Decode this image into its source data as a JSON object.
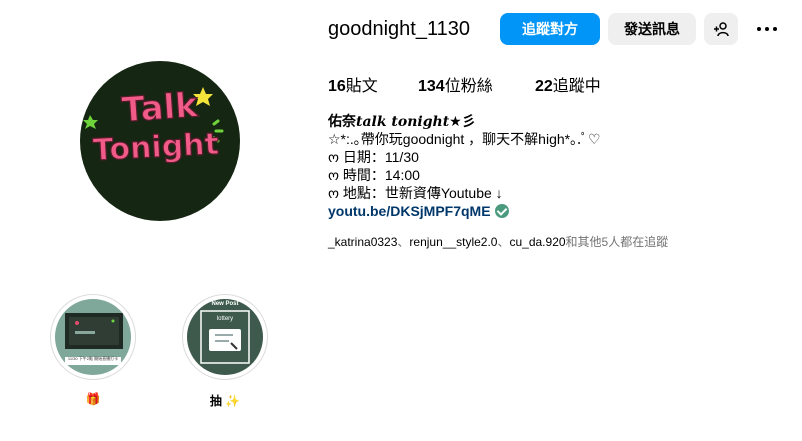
{
  "profile": {
    "username": "goodnight_1130",
    "avatar_text_line1": "Talk",
    "avatar_text_line2": "Tonight"
  },
  "actions": {
    "follow_label": "追蹤對方",
    "message_label": "發送訊息",
    "suggest_icon": "add-person-icon",
    "more_icon": "more-horizontal-icon"
  },
  "stats": {
    "posts_count": "16",
    "posts_label": "貼文",
    "followers_count": "134",
    "followers_label": "位粉絲",
    "following_count": "22",
    "following_label": "追蹤中"
  },
  "bio": {
    "name_prefix": "佑奈",
    "name_styled": "talk tonight",
    "name_suffix": "★彡",
    "line1": "☆*:.｡帶你玩goodnight ，聊天不解high*｡.ﾟ♡",
    "line2": "ო 日期：11/30",
    "line3": "ო 時間：14:00",
    "line4": "ო 地點：世新資傳Youtube ↓",
    "link": "youtu.be/DKSjMPF7qME"
  },
  "followed_by": {
    "user1": "_katrina0323",
    "sep1": "、",
    "user2": "renjun__style2.0",
    "sep2": "、",
    "user3": "cu_da.920",
    "rest": "和其他5人都在追蹤"
  },
  "highlights": [
    {
      "label": "🎁",
      "cover_caption": "11/30 下午2點 開始直播打卡"
    },
    {
      "label": "抽 ✨",
      "cover_title": "New Post",
      "cover_subtitle": "lottery"
    }
  ],
  "colors": {
    "primary_button": "#0095f6",
    "secondary_button": "#efefef",
    "avatar_bg": "#152712",
    "avatar_text": "#f15b87",
    "star_yellow": "#f5e43a",
    "star_green": "#6fd43c",
    "link": "#00376b",
    "muted": "#737373"
  }
}
